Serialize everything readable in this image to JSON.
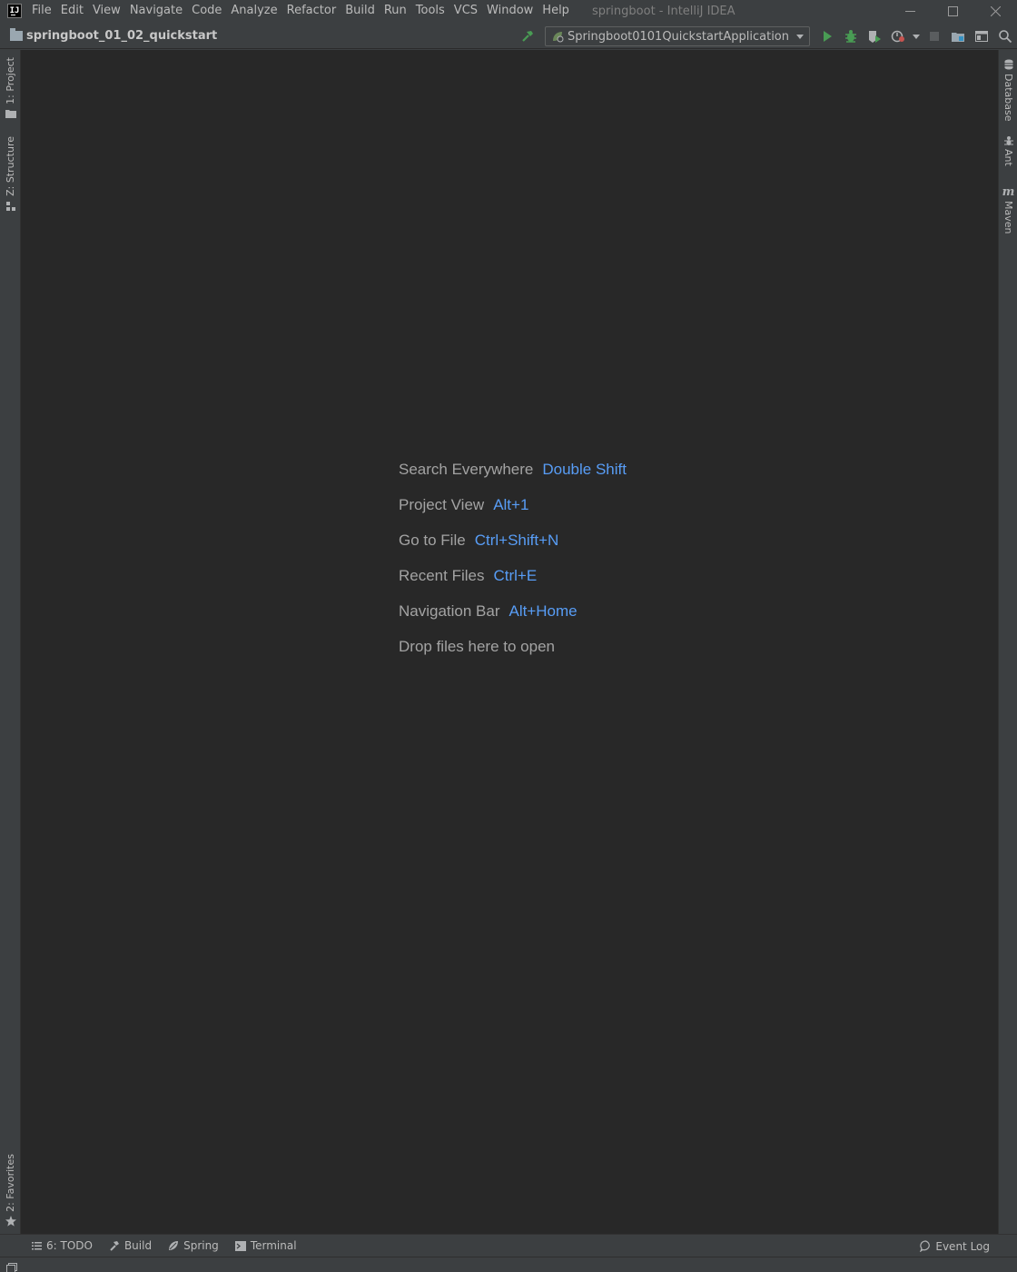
{
  "window": {
    "title": "springboot - IntelliJ IDEA",
    "app_icon_text": "IJ"
  },
  "menu": [
    {
      "mnemonic": "F",
      "rest": "ile"
    },
    {
      "mnemonic": "E",
      "rest": "dit"
    },
    {
      "mnemonic": "V",
      "rest": "iew"
    },
    {
      "mnemonic": "N",
      "rest": "avigate"
    },
    {
      "mnemonic": "C",
      "rest": "ode"
    },
    {
      "mnemonic": "",
      "rest": "Analyze",
      "prefix": "Analy",
      "mn2": "z",
      "suffix": "e"
    },
    {
      "mnemonic": "R",
      "rest": "efactor"
    },
    {
      "mnemonic": "B",
      "rest": "uild"
    },
    {
      "mnemonic": "",
      "rest": "Run"
    },
    {
      "mnemonic": "T",
      "rest": "ools"
    },
    {
      "mnemonic": "",
      "rest": "VCS"
    },
    {
      "mnemonic": "W",
      "rest": "indow"
    },
    {
      "mnemonic": "H",
      "rest": "elp"
    }
  ],
  "menu_labels": {
    "file": "File",
    "edit": "Edit",
    "view": "View",
    "navigate": "Navigate",
    "code": "Code",
    "analyze": "Analyze",
    "refactor": "Refactor",
    "build": "Build",
    "run": "Run",
    "tools": "Tools",
    "vcs": "VCS",
    "window": "Window",
    "help": "Help"
  },
  "navbar": {
    "project_name": "springboot_01_02_quickstart",
    "run_config": "Springboot0101QuickstartApplication"
  },
  "left_tabs": {
    "project": "1: Project",
    "structure": "Z: Structure",
    "favorites": "2: Favorites"
  },
  "right_tabs": {
    "database": "Database",
    "ant": "Ant",
    "maven": "Maven"
  },
  "hints": [
    {
      "label": "Search Everywhere",
      "key": "Double Shift"
    },
    {
      "label": "Project View",
      "key": "Alt+1"
    },
    {
      "label": "Go to File",
      "key": "Ctrl+Shift+N"
    },
    {
      "label": "Recent Files",
      "key": "Ctrl+E"
    },
    {
      "label": "Navigation Bar",
      "key": "Alt+Home"
    },
    {
      "label": "Drop files here to open",
      "key": ""
    }
  ],
  "bottom_tabs": {
    "todo": "6: TODO",
    "build": "Build",
    "spring": "Spring",
    "terminal": "Terminal",
    "event_log": "Event Log"
  },
  "colors": {
    "chrome_bg": "#3c3f41",
    "editor_bg": "#282828",
    "hint_text": "#a3a3a3",
    "hint_key": "#589df6",
    "run_green": "#499c54"
  }
}
